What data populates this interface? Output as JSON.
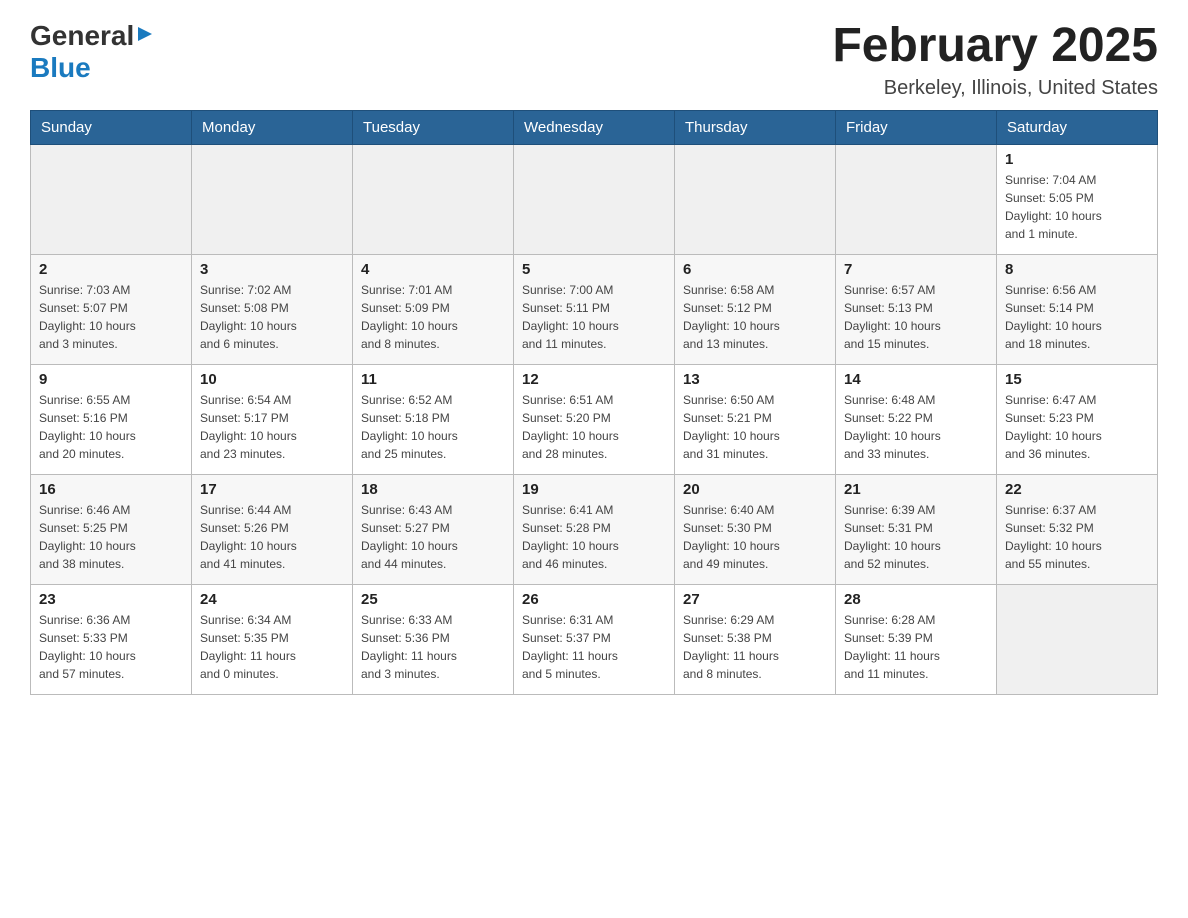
{
  "header": {
    "logo_general": "General",
    "logo_blue": "Blue",
    "month_title": "February 2025",
    "location": "Berkeley, Illinois, United States"
  },
  "days_of_week": [
    "Sunday",
    "Monday",
    "Tuesday",
    "Wednesday",
    "Thursday",
    "Friday",
    "Saturday"
  ],
  "weeks": [
    [
      {
        "day": "",
        "info": ""
      },
      {
        "day": "",
        "info": ""
      },
      {
        "day": "",
        "info": ""
      },
      {
        "day": "",
        "info": ""
      },
      {
        "day": "",
        "info": ""
      },
      {
        "day": "",
        "info": ""
      },
      {
        "day": "1",
        "info": "Sunrise: 7:04 AM\nSunset: 5:05 PM\nDaylight: 10 hours\nand 1 minute."
      }
    ],
    [
      {
        "day": "2",
        "info": "Sunrise: 7:03 AM\nSunset: 5:07 PM\nDaylight: 10 hours\nand 3 minutes."
      },
      {
        "day": "3",
        "info": "Sunrise: 7:02 AM\nSunset: 5:08 PM\nDaylight: 10 hours\nand 6 minutes."
      },
      {
        "day": "4",
        "info": "Sunrise: 7:01 AM\nSunset: 5:09 PM\nDaylight: 10 hours\nand 8 minutes."
      },
      {
        "day": "5",
        "info": "Sunrise: 7:00 AM\nSunset: 5:11 PM\nDaylight: 10 hours\nand 11 minutes."
      },
      {
        "day": "6",
        "info": "Sunrise: 6:58 AM\nSunset: 5:12 PM\nDaylight: 10 hours\nand 13 minutes."
      },
      {
        "day": "7",
        "info": "Sunrise: 6:57 AM\nSunset: 5:13 PM\nDaylight: 10 hours\nand 15 minutes."
      },
      {
        "day": "8",
        "info": "Sunrise: 6:56 AM\nSunset: 5:14 PM\nDaylight: 10 hours\nand 18 minutes."
      }
    ],
    [
      {
        "day": "9",
        "info": "Sunrise: 6:55 AM\nSunset: 5:16 PM\nDaylight: 10 hours\nand 20 minutes."
      },
      {
        "day": "10",
        "info": "Sunrise: 6:54 AM\nSunset: 5:17 PM\nDaylight: 10 hours\nand 23 minutes."
      },
      {
        "day": "11",
        "info": "Sunrise: 6:52 AM\nSunset: 5:18 PM\nDaylight: 10 hours\nand 25 minutes."
      },
      {
        "day": "12",
        "info": "Sunrise: 6:51 AM\nSunset: 5:20 PM\nDaylight: 10 hours\nand 28 minutes."
      },
      {
        "day": "13",
        "info": "Sunrise: 6:50 AM\nSunset: 5:21 PM\nDaylight: 10 hours\nand 31 minutes."
      },
      {
        "day": "14",
        "info": "Sunrise: 6:48 AM\nSunset: 5:22 PM\nDaylight: 10 hours\nand 33 minutes."
      },
      {
        "day": "15",
        "info": "Sunrise: 6:47 AM\nSunset: 5:23 PM\nDaylight: 10 hours\nand 36 minutes."
      }
    ],
    [
      {
        "day": "16",
        "info": "Sunrise: 6:46 AM\nSunset: 5:25 PM\nDaylight: 10 hours\nand 38 minutes."
      },
      {
        "day": "17",
        "info": "Sunrise: 6:44 AM\nSunset: 5:26 PM\nDaylight: 10 hours\nand 41 minutes."
      },
      {
        "day": "18",
        "info": "Sunrise: 6:43 AM\nSunset: 5:27 PM\nDaylight: 10 hours\nand 44 minutes."
      },
      {
        "day": "19",
        "info": "Sunrise: 6:41 AM\nSunset: 5:28 PM\nDaylight: 10 hours\nand 46 minutes."
      },
      {
        "day": "20",
        "info": "Sunrise: 6:40 AM\nSunset: 5:30 PM\nDaylight: 10 hours\nand 49 minutes."
      },
      {
        "day": "21",
        "info": "Sunrise: 6:39 AM\nSunset: 5:31 PM\nDaylight: 10 hours\nand 52 minutes."
      },
      {
        "day": "22",
        "info": "Sunrise: 6:37 AM\nSunset: 5:32 PM\nDaylight: 10 hours\nand 55 minutes."
      }
    ],
    [
      {
        "day": "23",
        "info": "Sunrise: 6:36 AM\nSunset: 5:33 PM\nDaylight: 10 hours\nand 57 minutes."
      },
      {
        "day": "24",
        "info": "Sunrise: 6:34 AM\nSunset: 5:35 PM\nDaylight: 11 hours\nand 0 minutes."
      },
      {
        "day": "25",
        "info": "Sunrise: 6:33 AM\nSunset: 5:36 PM\nDaylight: 11 hours\nand 3 minutes."
      },
      {
        "day": "26",
        "info": "Sunrise: 6:31 AM\nSunset: 5:37 PM\nDaylight: 11 hours\nand 5 minutes."
      },
      {
        "day": "27",
        "info": "Sunrise: 6:29 AM\nSunset: 5:38 PM\nDaylight: 11 hours\nand 8 minutes."
      },
      {
        "day": "28",
        "info": "Sunrise: 6:28 AM\nSunset: 5:39 PM\nDaylight: 11 hours\nand 11 minutes."
      },
      {
        "day": "",
        "info": ""
      }
    ]
  ]
}
